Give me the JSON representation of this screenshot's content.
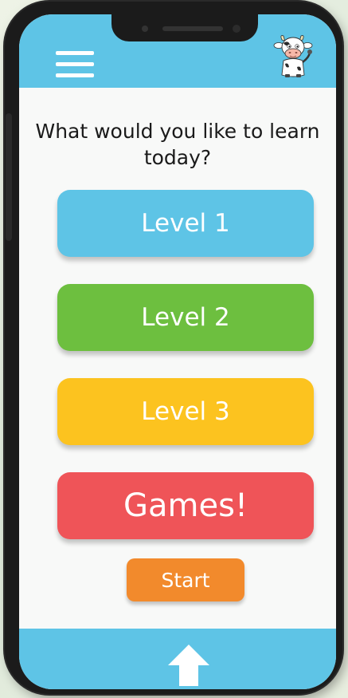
{
  "header": {
    "menu_icon": "hamburger-menu-icon",
    "mascot_icon": "cow-mascot-icon"
  },
  "main": {
    "prompt": "What would you like to learn today?",
    "buttons": [
      {
        "label": "Level 1",
        "color": "#5ec4e6"
      },
      {
        "label": "Level 2",
        "color": "#6dbf3f"
      },
      {
        "label": "Level 3",
        "color": "#fcc31f"
      },
      {
        "label": "Games!",
        "color": "#ef5458"
      }
    ],
    "start_label": "Start",
    "start_color": "#f28a2c"
  },
  "footer": {
    "nav_icon": "up-arrow-icon"
  },
  "colors": {
    "accent": "#5ec4e6",
    "background": "#f8f9f8"
  }
}
